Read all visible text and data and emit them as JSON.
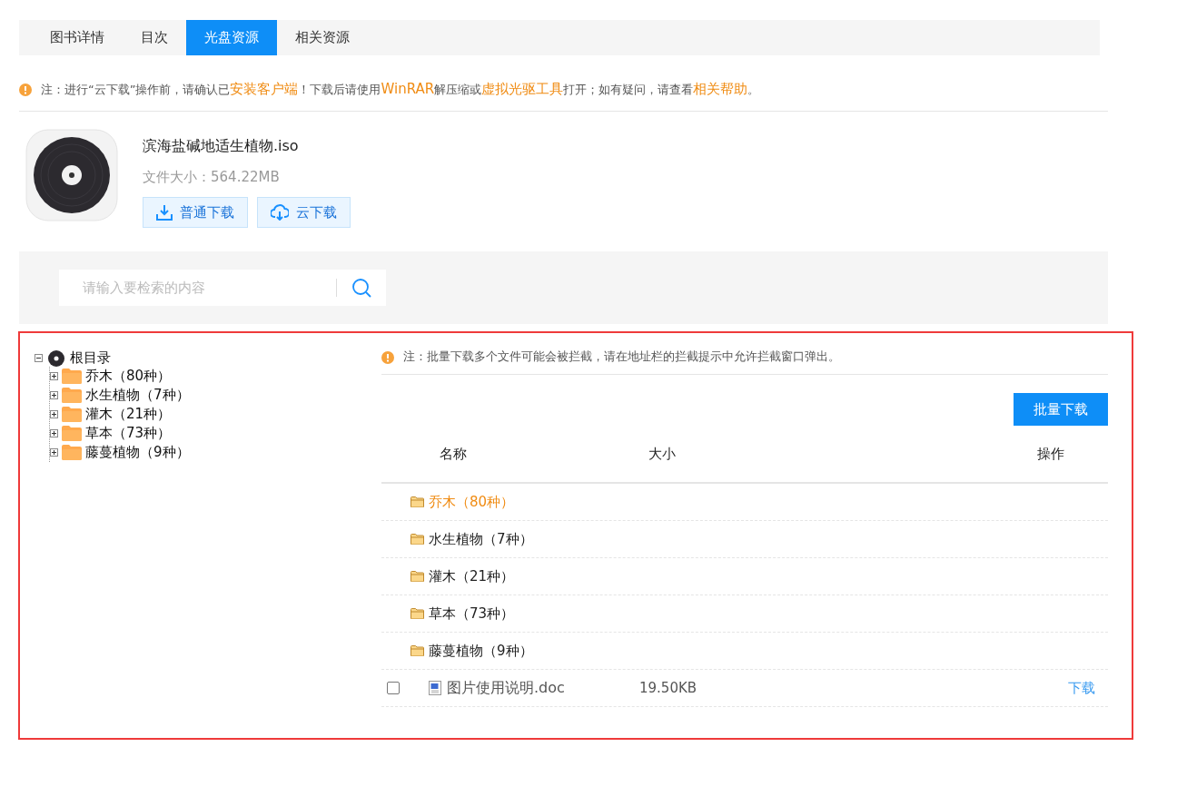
{
  "tabs": [
    {
      "label": "图书详情",
      "selected": false
    },
    {
      "label": "目次",
      "selected": false
    },
    {
      "label": "光盘资源",
      "selected": true
    },
    {
      "label": "相关资源",
      "selected": false
    }
  ],
  "notice": [
    {
      "kind": "plain",
      "text": "注：进行“云下载”操作前，请确认已"
    },
    {
      "kind": "link",
      "text": "安装客户端"
    },
    {
      "kind": "plain",
      "text": "！下载后请使用"
    },
    {
      "kind": "link",
      "text": "WinRAR"
    },
    {
      "kind": "plain",
      "text": "解压缩或"
    },
    {
      "kind": "link",
      "text": "虚拟光驱工具"
    },
    {
      "kind": "plain",
      "text": "打开；如有疑问，请查看"
    },
    {
      "kind": "link",
      "text": "相关帮助"
    },
    {
      "kind": "plain",
      "text": "。"
    }
  ],
  "file": {
    "name": "滨海盐碱地适生植物.iso",
    "size": "文件大小：564.22MB",
    "buttons": [
      {
        "kind": "download",
        "label": "普通下载"
      },
      {
        "kind": "cloud",
        "label": "云下载"
      }
    ]
  },
  "search": {
    "placeholder": "请输入要检索的内容"
  },
  "tree": {
    "label": "根目录",
    "expanded": true,
    "children": [
      {
        "label": "乔木（80种）",
        "expanded": false
      },
      {
        "label": "水生植物（7种）",
        "expanded": false
      },
      {
        "label": "灌木（21种）",
        "expanded": false
      },
      {
        "label": "草本（73种）",
        "expanded": false
      },
      {
        "label": "藤蔓植物（9种）",
        "expanded": false
      }
    ]
  },
  "batch_notice": "注：批量下载多个文件可能会被拦截，请在地址栏的拦截提示中允许拦截窗口弹出。",
  "batch_button": "批量下载",
  "table": {
    "columns": [
      "名称",
      "大小",
      "操作"
    ],
    "rows": [
      {
        "kind": "folder",
        "name": "乔木（80种）",
        "highlighted": true
      },
      {
        "kind": "folder",
        "name": "水生植物（7种）",
        "highlighted": false
      },
      {
        "kind": "folder",
        "name": "灌木（21种）",
        "highlighted": false
      },
      {
        "kind": "folder",
        "name": "草本（73种）",
        "highlighted": false
      },
      {
        "kind": "folder",
        "name": "藤蔓植物（9种）",
        "highlighted": false
      },
      {
        "kind": "file",
        "name": "图片使用说明.doc",
        "size": "19.50KB",
        "action": "下载",
        "checked": false,
        "highlighted": false
      }
    ]
  }
}
